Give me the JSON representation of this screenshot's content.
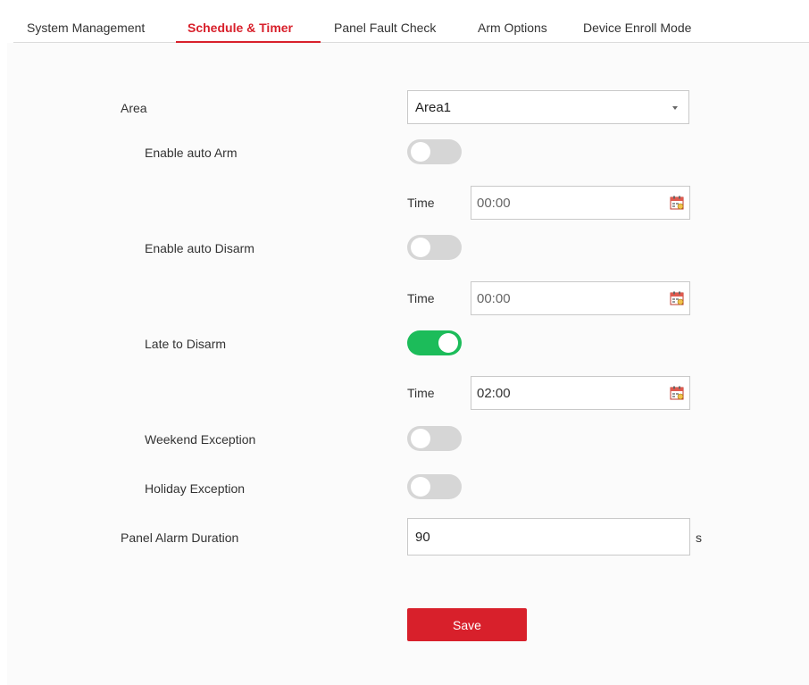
{
  "tabs": [
    {
      "label": "System Management",
      "active": false
    },
    {
      "label": "Schedule & Timer",
      "active": true
    },
    {
      "label": "Panel Fault Check",
      "active": false
    },
    {
      "label": "Arm Options",
      "active": false
    },
    {
      "label": "Device Enroll Mode",
      "active": false
    }
  ],
  "form": {
    "area": {
      "label": "Area",
      "value": "Area1"
    },
    "auto_arm": {
      "label": "Enable auto Arm",
      "enabled": false,
      "time_label": "Time",
      "time": "00:00"
    },
    "auto_disarm": {
      "label": "Enable auto Disarm",
      "enabled": false,
      "time_label": "Time",
      "time": "00:00"
    },
    "late_to_disarm": {
      "label": "Late to Disarm",
      "enabled": true,
      "time_label": "Time",
      "time": "02:00"
    },
    "weekend_exception": {
      "label": "Weekend Exception",
      "enabled": false
    },
    "holiday_exception": {
      "label": "Holiday Exception",
      "enabled": false
    },
    "panel_alarm_duration": {
      "label": "Panel Alarm Duration",
      "value": "90",
      "unit": "s"
    },
    "save_label": "Save"
  },
  "colors": {
    "accent": "#d8202b",
    "toggle_on": "#1cbc5a",
    "toggle_off": "#d6d6d6"
  },
  "icons": {
    "time_picker": "calendar-icon",
    "select": "caret-down-icon"
  }
}
